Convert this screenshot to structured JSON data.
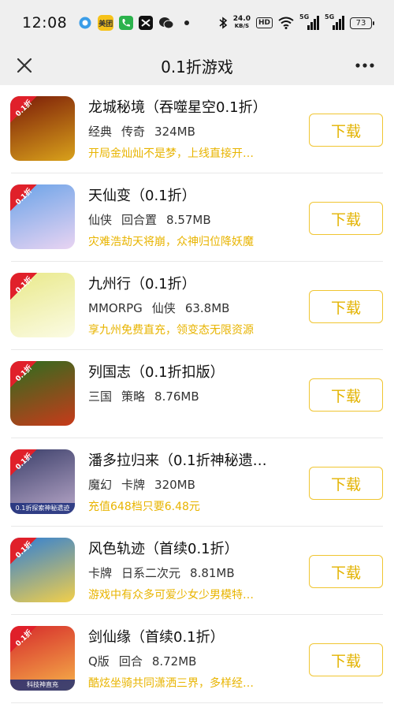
{
  "status_bar": {
    "time": "12:08",
    "net_speed_value": "24.0",
    "net_speed_unit": "KB/S",
    "hd_label": "HD",
    "signal1_label": "5G",
    "signal2_label": "5G",
    "battery": "73",
    "app_icon_label": "美团"
  },
  "header": {
    "title": "0.1折游戏"
  },
  "download_label": "下载",
  "discount_tag": "0.1折",
  "games": [
    {
      "title": "龙城秘境（吞噬星空0.1折）",
      "tags": [
        "经典",
        "传奇",
        "324MB"
      ],
      "desc": "开局金灿灿不是梦，上线直接开…",
      "colors": [
        "#7a1a08",
        "#d9a21b"
      ]
    },
    {
      "title": "天仙变（0.1折）",
      "tags": [
        "仙侠",
        "回合置",
        "8.57MB"
      ],
      "desc": "灾难浩劫天将崩，众神归位降妖魔",
      "colors": [
        "#6aa3e8",
        "#e9d4f2"
      ]
    },
    {
      "title": "九州行（0.1折）",
      "tags": [
        "MMORPG",
        "仙侠",
        "63.8MB"
      ],
      "desc": "享九州免费直充，领变态无限资源",
      "colors": [
        "#e9e98a",
        "#fbfbe4"
      ]
    },
    {
      "title": "列国志（0.1折扣版）",
      "tags": [
        "三国",
        "策略",
        "8.76MB"
      ],
      "desc": "",
      "colors": [
        "#2c6e1f",
        "#c83a1a"
      ]
    },
    {
      "title": "潘多拉归来（0.1折神秘遗…",
      "tags": [
        "魔幻",
        "卡牌",
        "320MB"
      ],
      "desc": "充值648档只要6.48元",
      "colors": [
        "#3b3f6a",
        "#b9a8c9"
      ],
      "banner": "0.1折探索神秘遗迹"
    },
    {
      "title": "风色轨迹（首续0.1折）",
      "tags": [
        "卡牌",
        "日系二次元",
        "8.81MB"
      ],
      "desc": "游戏中有众多可爱少女少男模特…",
      "colors": [
        "#2f7fd6",
        "#f2cf4a"
      ]
    },
    {
      "title": "剑仙缘（首续0.1折）",
      "tags": [
        "Q版",
        "回合",
        "8.72MB"
      ],
      "desc": "酷炫坐骑共同潇洒三界，多样经…",
      "colors": [
        "#d62b2b",
        "#f6b24a"
      ],
      "banner": "科技神直充"
    }
  ]
}
